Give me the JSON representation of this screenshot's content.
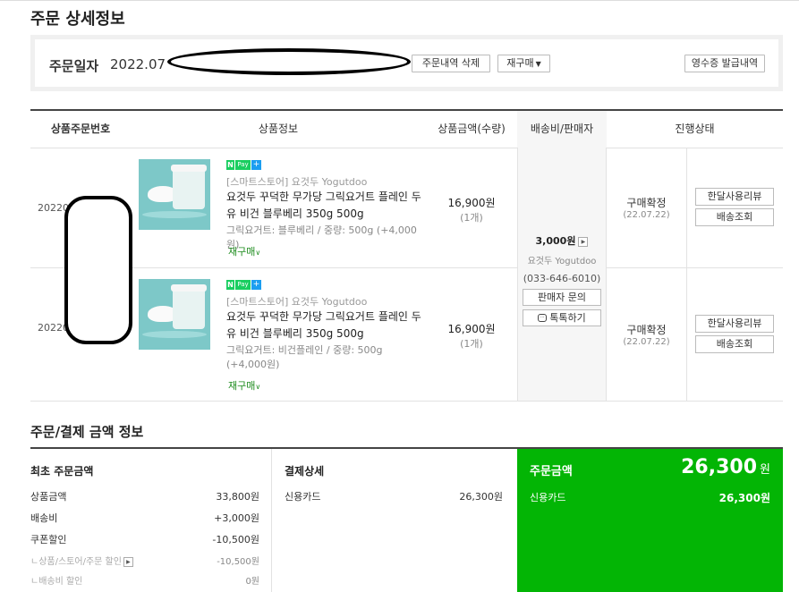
{
  "page": {
    "title": "주문 상세정보"
  },
  "order_date": {
    "label": "주문일자",
    "value": "2022.07",
    "delete_label": "주문내역 삭제",
    "reorder_label": "재구매",
    "receipt_label": "영수증 발급내역"
  },
  "table": {
    "headers": {
      "no": "상품주문번호",
      "info": "상품정보",
      "price": "상품금액(수량)",
      "ship": "배송비/판매자",
      "status": "진행상태"
    },
    "rows": [
      {
        "no": "20220",
        "store": "[스마트스토어] 요것두 Yogutdoo",
        "name": "요것두 꾸덕한 무가당 그릭요거트 플레인 두유 비건 블루베리 350g 500g",
        "option": "그릭요거트: 블루베리 / 중량: 500g (+4,000원)",
        "rebuy": "재구매",
        "price": "16,900원",
        "qty": "(1개)",
        "status": "구매확정",
        "status_date": "(22.07.22)",
        "review_label": "한달사용리뷰",
        "track_label": "배송조회"
      },
      {
        "no": "20220",
        "store": "[스마트스토어] 요것두 Yogutdoo",
        "name": "요것두 꾸덕한 무가당 그릭요거트 플레인 두유 비건 블루베리 350g 500g",
        "option": "그릭요거트: 비건플레인 / 중량: 500g (+4,000원)",
        "rebuy": "재구매",
        "price": "16,900원",
        "qty": "(1개)",
        "status": "구매확정",
        "status_date": "(22.07.22)",
        "review_label": "한달사용리뷰",
        "track_label": "배송조회"
      }
    ],
    "shipping": {
      "fee": "3,000원",
      "seller": "요것두 Yogutdoo",
      "phone": "(033-646-6010)",
      "inquiry_label": "판매자 문의",
      "talk_label": "톡톡하기"
    },
    "npay": {
      "n": "N",
      "pay": "Pay",
      "plus": "+"
    }
  },
  "payment": {
    "title": "주문/결제 금액 정보",
    "initial": {
      "title": "최초 주문금액",
      "rows": [
        {
          "k": "상품금액",
          "v": "33,800원"
        },
        {
          "k": "배송비",
          "v": "+3,000원"
        },
        {
          "k": "쿠폰할인",
          "v": "-10,500원"
        },
        {
          "k": "ㄴ상품/스토어/주문 할인",
          "v": "-10,500원"
        },
        {
          "k": "ㄴ배송비 할인",
          "v": "0원"
        }
      ]
    },
    "detail": {
      "title": "결제상세",
      "method": "신용카드",
      "amount": "26,300원"
    },
    "total": {
      "label": "주문금액",
      "amount": "26,300",
      "won": "원",
      "method": "신용카드",
      "method_amount": "26,300원"
    }
  }
}
